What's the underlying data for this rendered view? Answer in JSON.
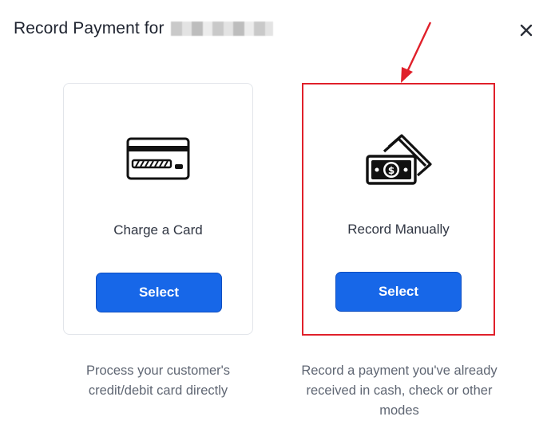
{
  "dialog": {
    "title": "Record Payment for",
    "close_icon": "close-icon"
  },
  "options": [
    {
      "label": "Charge a Card",
      "button": "Select",
      "description": "Process your customer's credit/debit card directly",
      "icon": "credit-card-icon"
    },
    {
      "label": "Record Manually",
      "button": "Select",
      "description": "Record a payment you've already received in cash, check or other modes",
      "icon": "cash-icon"
    }
  ],
  "colors": {
    "primary_button": "#1767e8",
    "highlight": "#e0202a"
  }
}
